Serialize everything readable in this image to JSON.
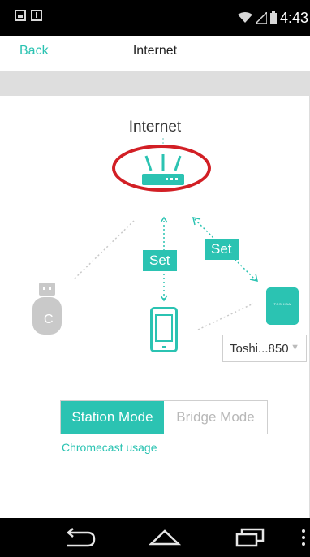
{
  "status_bar": {
    "time": "4:43"
  },
  "header": {
    "back_label": "Back",
    "title": "Internet"
  },
  "diagram": {
    "internet_label": "Internet",
    "set_tags": [
      "Set",
      "Set"
    ],
    "selected_device": "Toshi...850",
    "toshiba_brand": "TOSHIBA",
    "chromecast_letter": "C"
  },
  "mode": {
    "options": [
      "Station Mode",
      "Bridge Mode"
    ],
    "selected": "Station Mode"
  },
  "chromecast_link": "Chromecast usage",
  "colors": {
    "accent": "#2bc3b2",
    "highlight": "#d21f25"
  }
}
